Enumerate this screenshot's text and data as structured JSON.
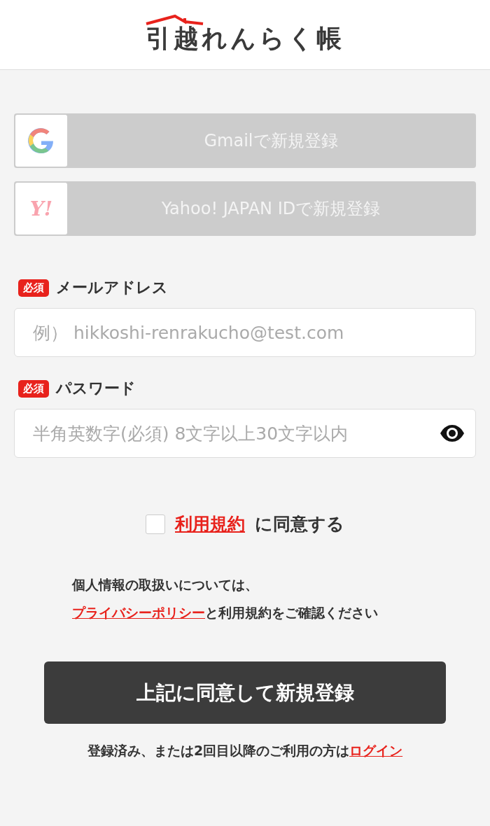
{
  "header": {
    "logo": "引越れんらく帳"
  },
  "social_buttons": [
    {
      "kind": "google",
      "label": "Gmailで新規登録",
      "disabled": true
    },
    {
      "kind": "yahoo",
      "label": "Yahoo! JAPAN IDで新規登録",
      "logo_text": "Y!",
      "disabled": true
    }
  ],
  "fields": [
    {
      "kind": "email",
      "badge": "必須",
      "label": "メールアドレス",
      "placeholder": "例） hikkoshi-renrakucho@test.com"
    },
    {
      "kind": "password",
      "badge": "必須",
      "label": "パスワード",
      "placeholder": "半角英数字(必須) 8文字以上30文字以内"
    }
  ],
  "agreement": {
    "checked": false,
    "link": "利用規約",
    "text": "に同意する"
  },
  "privacy_note": {
    "line1": "個人情報の取扱いについては、",
    "link": "プライバシーポリシー",
    "text": "と利用規約をご確認ください"
  },
  "submit_button": "上記に同意して新規登録",
  "login_note": {
    "text": "登録済み、または2回目以降のご利用の方は",
    "link": "ログイン"
  }
}
